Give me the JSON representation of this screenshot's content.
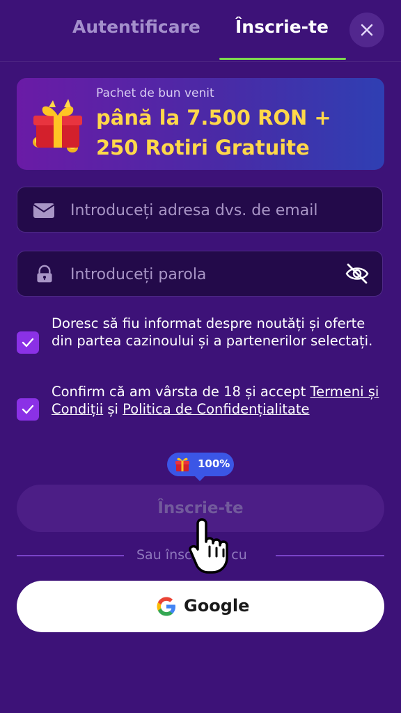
{
  "tabs": {
    "login_label": "Autentificare",
    "signup_label": "Înscrie-te"
  },
  "bonus": {
    "subtitle": "Pachet de bun venit",
    "title": "până la 7.500 RON + 250 Rotiri Gratuite"
  },
  "form": {
    "email_placeholder": "Introduceți adresa dvs. de email",
    "password_placeholder": "Introduceți parola",
    "newsletter_label": "Doresc să fiu informat despre noutăți și oferte din partea cazinoului și a partenerilor selectați.",
    "terms_prefix": "Confirm că am vârsta de 18 și accept ",
    "terms_link": "Termeni și Condiții",
    "terms_and": " și ",
    "privacy_link": "Politica de Confidențialitate",
    "newsletter_checked": true,
    "terms_checked": true
  },
  "progress": {
    "value": "100%"
  },
  "submit_label": "Înscrie-te",
  "divider_text": "Sau înscrie-te cu",
  "google_label": "Google",
  "colors": {
    "background": "#3d1278",
    "accent_underline": "#7dd84f",
    "bonus_text": "#ffd84a",
    "checkbox": "#8b31e6",
    "tooltip": "#3b56e6"
  },
  "icons": {
    "close": "close-icon",
    "gift": "gift-icon",
    "email": "envelope-icon",
    "password": "lock-icon",
    "eye": "eye-off-icon",
    "check": "check-icon",
    "google": "google-logo-icon",
    "cursor": "hand-pointer-icon"
  }
}
